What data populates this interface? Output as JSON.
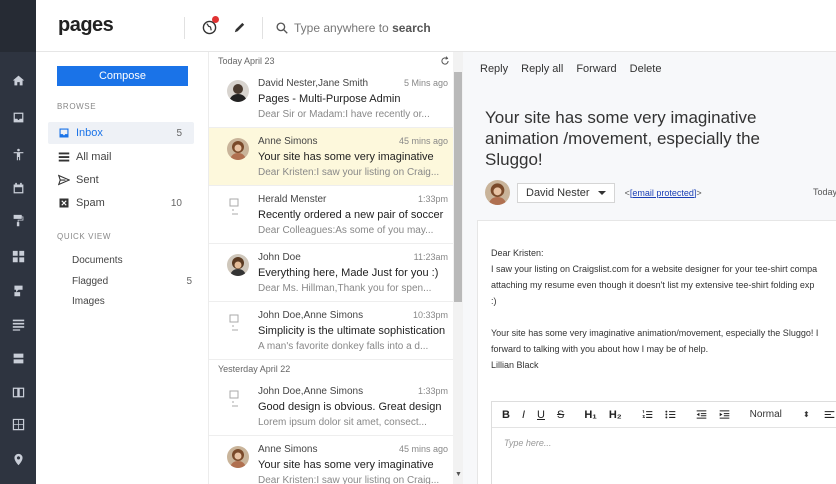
{
  "brand": {
    "logo": "pages"
  },
  "header": {
    "search_placeholder_pre": "Type anywhere to ",
    "search_placeholder_bold": "search"
  },
  "folders": {
    "compose_label": "Compose",
    "browse_title": "BROWSE",
    "items": [
      {
        "label": "Inbox",
        "count": "5"
      },
      {
        "label": "All mail",
        "count": ""
      },
      {
        "label": "Sent",
        "count": ""
      },
      {
        "label": "Spam",
        "count": "10"
      }
    ],
    "quick_title": "QUICK VIEW",
    "quick": [
      {
        "label": "Documents",
        "count": ""
      },
      {
        "label": "Flagged",
        "count": "5"
      },
      {
        "label": "Images",
        "count": ""
      }
    ]
  },
  "list": {
    "day1": "Today April 23",
    "day2": "Yesterday April 22",
    "messages": [
      {
        "from": "David Nester,Jane Smith",
        "time": "5 Mins ago",
        "subject": "Pages - Multi-Purpose Admin",
        "preview": "Dear Sir or Madam:I have recently or..."
      },
      {
        "from": "Anne Simons",
        "time": "45 mins ago",
        "subject": "Your site has some very imaginative",
        "preview": "Dear Kristen:I saw your listing on Craig..."
      },
      {
        "from": "Herald Menster",
        "time": "1:33pm",
        "subject": "Recently ordered a new pair of soccer",
        "preview": "Dear Colleagues:As some of you may..."
      },
      {
        "from": "John Doe",
        "time": "11:23am",
        "subject": "Everything here, Made Just for you :)",
        "preview": "Dear Ms. Hillman,Thank you for spen..."
      },
      {
        "from": "John Doe,Anne Simons",
        "time": "10:33pm",
        "subject": "Simplicity is the ultimate sophistication",
        "preview": "A man's favorite donkey falls into a d..."
      },
      {
        "from": "John Doe,Anne Simons",
        "time": "1:33pm",
        "subject": "Good design is obvious. Great design",
        "preview": "Lorem ipsum dolor sit amet, consect..."
      },
      {
        "from": "Anne Simons",
        "time": "45 mins ago",
        "subject": "Your site has some very imaginative",
        "preview": "Dear Kristen:I saw your listing on Craig..."
      }
    ]
  },
  "pane": {
    "actions": [
      "Reply",
      "Reply all",
      "Forward",
      "Delete"
    ],
    "title": "Your site has some very imaginative animation /movement, especially the Sluggo!",
    "sender_name": "David Nester",
    "email_open": "<",
    "email_link": "[email protected]",
    "email_close": ">",
    "date": "Today",
    "body": [
      "Dear Kristen:",
      "I saw your listing on Craigslist.com for a website designer for your tee-shirt compa",
      "attaching my resume even though it doesn't list my extensive tee-shirt folding exp",
      ":)",
      "",
      "Your site has some very imaginative animation/movement, especially the Sluggo! I",
      "forward to talking with you about how I may be of help.",
      "Lillian Black"
    ],
    "toolbar": {
      "bold": "B",
      "italic": "I",
      "underline": "U",
      "strike": "S",
      "h1": "H₁",
      "h2": "H₂",
      "style": "Normal"
    },
    "editor_placeholder": "Type here..."
  },
  "colors": {
    "accent": "#1a73e8",
    "rail": "#2e3440",
    "selected_row": "#fdf8dc",
    "notify": "#e03232"
  }
}
